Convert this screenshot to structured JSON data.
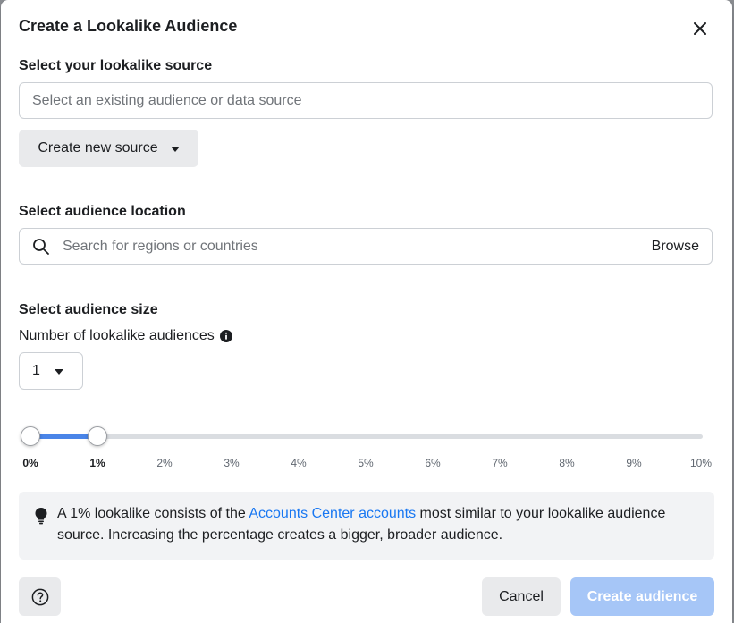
{
  "dialog": {
    "title": "Create a Lookalike Audience",
    "close_icon": "close-icon"
  },
  "source": {
    "label": "Select your lookalike source",
    "placeholder": "Select an existing audience or data source",
    "create_button": "Create new source"
  },
  "location": {
    "label": "Select audience location",
    "placeholder": "Search for regions or countries",
    "browse": "Browse",
    "search_icon": "search-icon"
  },
  "size": {
    "label": "Select audience size",
    "count_label": "Number of lookalike audiences",
    "count_value": "1",
    "range_start_percent": 0,
    "range_end_percent": 1,
    "ticks": [
      "0%",
      "1%",
      "2%",
      "3%",
      "4%",
      "5%",
      "6%",
      "7%",
      "8%",
      "9%",
      "10%"
    ]
  },
  "info": {
    "text_before": "A 1% lookalike consists of the ",
    "link": "Accounts Center accounts",
    "text_after": " most similar to your lookalike audience source. Increasing the percentage creates a bigger, broader audience."
  },
  "footer": {
    "cancel": "Cancel",
    "create": "Create audience"
  },
  "colors": {
    "accent": "#1877f2",
    "slider_fill": "#4a85e8",
    "disabled_button": "#a6c6f7"
  }
}
